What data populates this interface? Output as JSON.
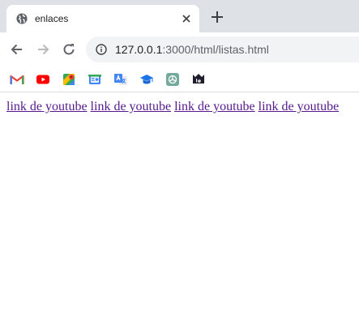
{
  "tab": {
    "title": "enlaces"
  },
  "address_bar": {
    "host": "127.0.0.1",
    "path": ":3000/html/listas.html"
  },
  "bookmarks": [
    "gmail-icon",
    "youtube-icon",
    "maps-icon",
    "news-icon",
    "translate-icon",
    "classroom-icon",
    "chatgpt-icon",
    "mastodon-icon"
  ],
  "page": {
    "links": [
      {
        "text": "link de youtube"
      },
      {
        "text": "link de youtube"
      },
      {
        "text": "link de youtube"
      },
      {
        "text": "link de youtube"
      }
    ],
    "link_color": "#551a8b"
  }
}
